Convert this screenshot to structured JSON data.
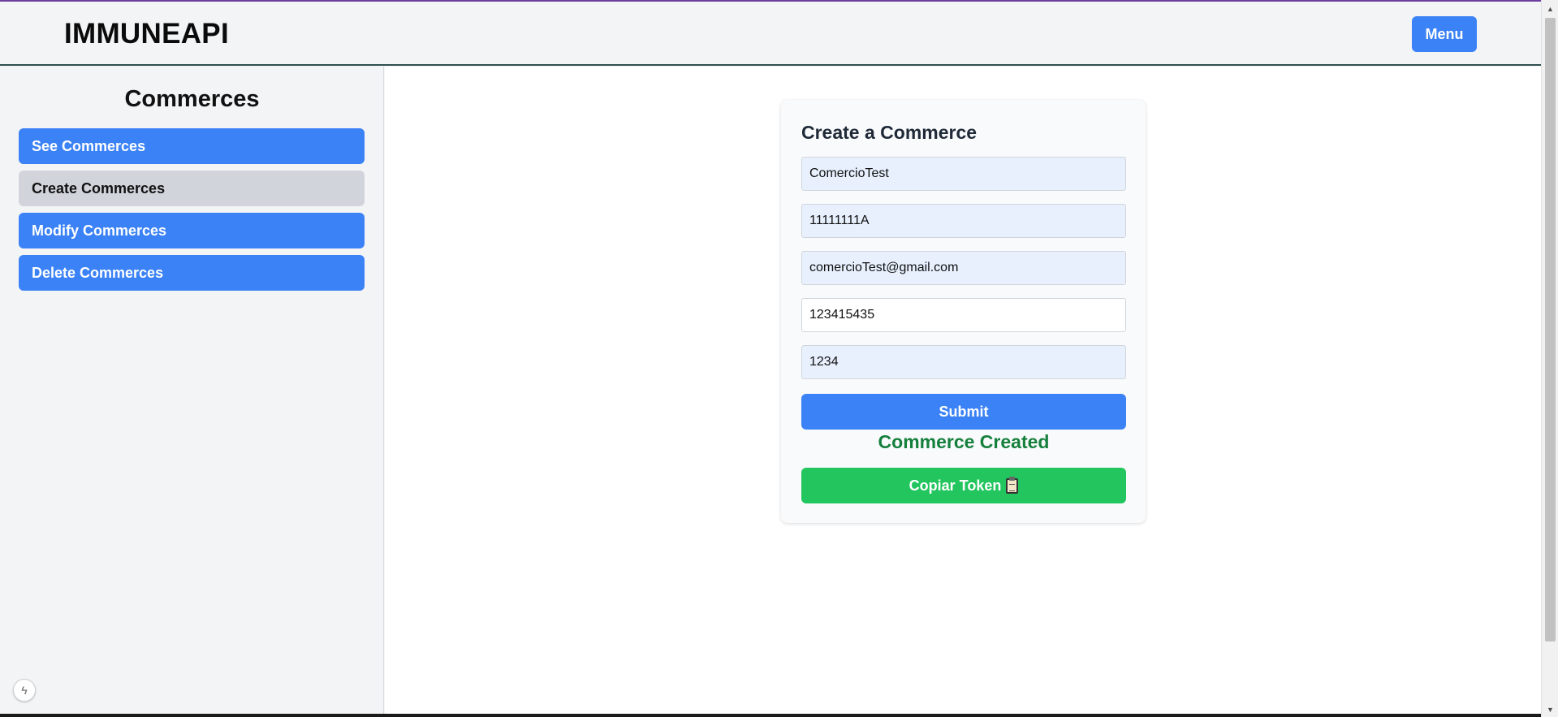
{
  "header": {
    "brand": "IMMUNEAPI",
    "menu_label": "Menu"
  },
  "sidebar": {
    "title": "Commerces",
    "items": [
      {
        "label": "See Commerces",
        "active": false
      },
      {
        "label": "Create Commerces",
        "active": true
      },
      {
        "label": "Modify Commerces",
        "active": false
      },
      {
        "label": "Delete Commerces",
        "active": false
      }
    ]
  },
  "form": {
    "title": "Create a Commerce",
    "fields": [
      {
        "value": "ComercioTest"
      },
      {
        "value": "11111111A"
      },
      {
        "value": "comercioTest@gmail.com"
      },
      {
        "value": "123415435"
      },
      {
        "value": "1234"
      }
    ],
    "submit_label": "Submit",
    "status_message": "Commerce Created",
    "copy_label": "Copiar Token",
    "copy_icon": "clipboard-icon"
  },
  "colors": {
    "primary": "#3b82f6",
    "success_text": "#15803d",
    "success_button": "#22c55e",
    "active_item": "#d1d5db"
  }
}
